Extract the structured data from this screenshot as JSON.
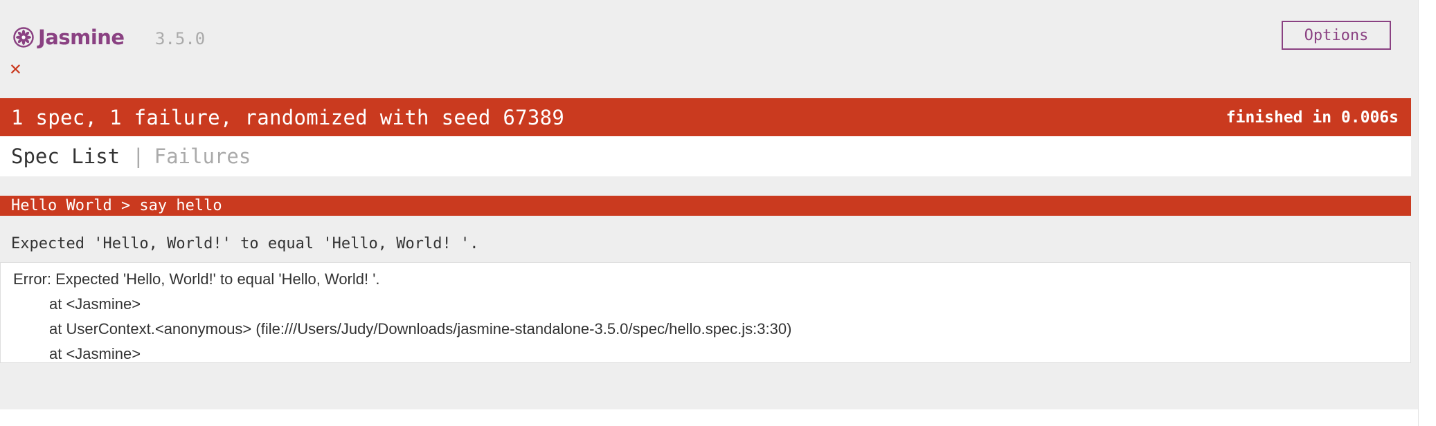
{
  "app": {
    "name": "Jasmine",
    "version": "3.5.0",
    "brand_color": "#8a4182",
    "failure_color": "#ca3a1f"
  },
  "banner": {
    "logo_text": "Jasmine",
    "logo_icon": "jasmine-flower-icon",
    "version_label": "3.5.0",
    "options_label": "Options"
  },
  "symbol_summary": {
    "icon": "failed-spec-x-icon",
    "glyph": "✕"
  },
  "result_bar": {
    "summary": "1 spec, 1 failure, randomized with seed 67389",
    "duration": "finished in 0.006s"
  },
  "menu": {
    "spec_list_label": "Spec List",
    "separator": "|",
    "failures_label": "Failures"
  },
  "failure": {
    "description": "Hello World > say hello",
    "message": "Expected 'Hello, World!' to equal 'Hello, World! '.",
    "stack": [
      "Error: Expected 'Hello, World!' to equal 'Hello, World! '.",
      "at <Jasmine>",
      "at UserContext.<anonymous> (file:///Users/Judy/Downloads/jasmine-standalone-3.5.0/spec/hello.spec.js:3:30)",
      "at <Jasmine>"
    ]
  }
}
